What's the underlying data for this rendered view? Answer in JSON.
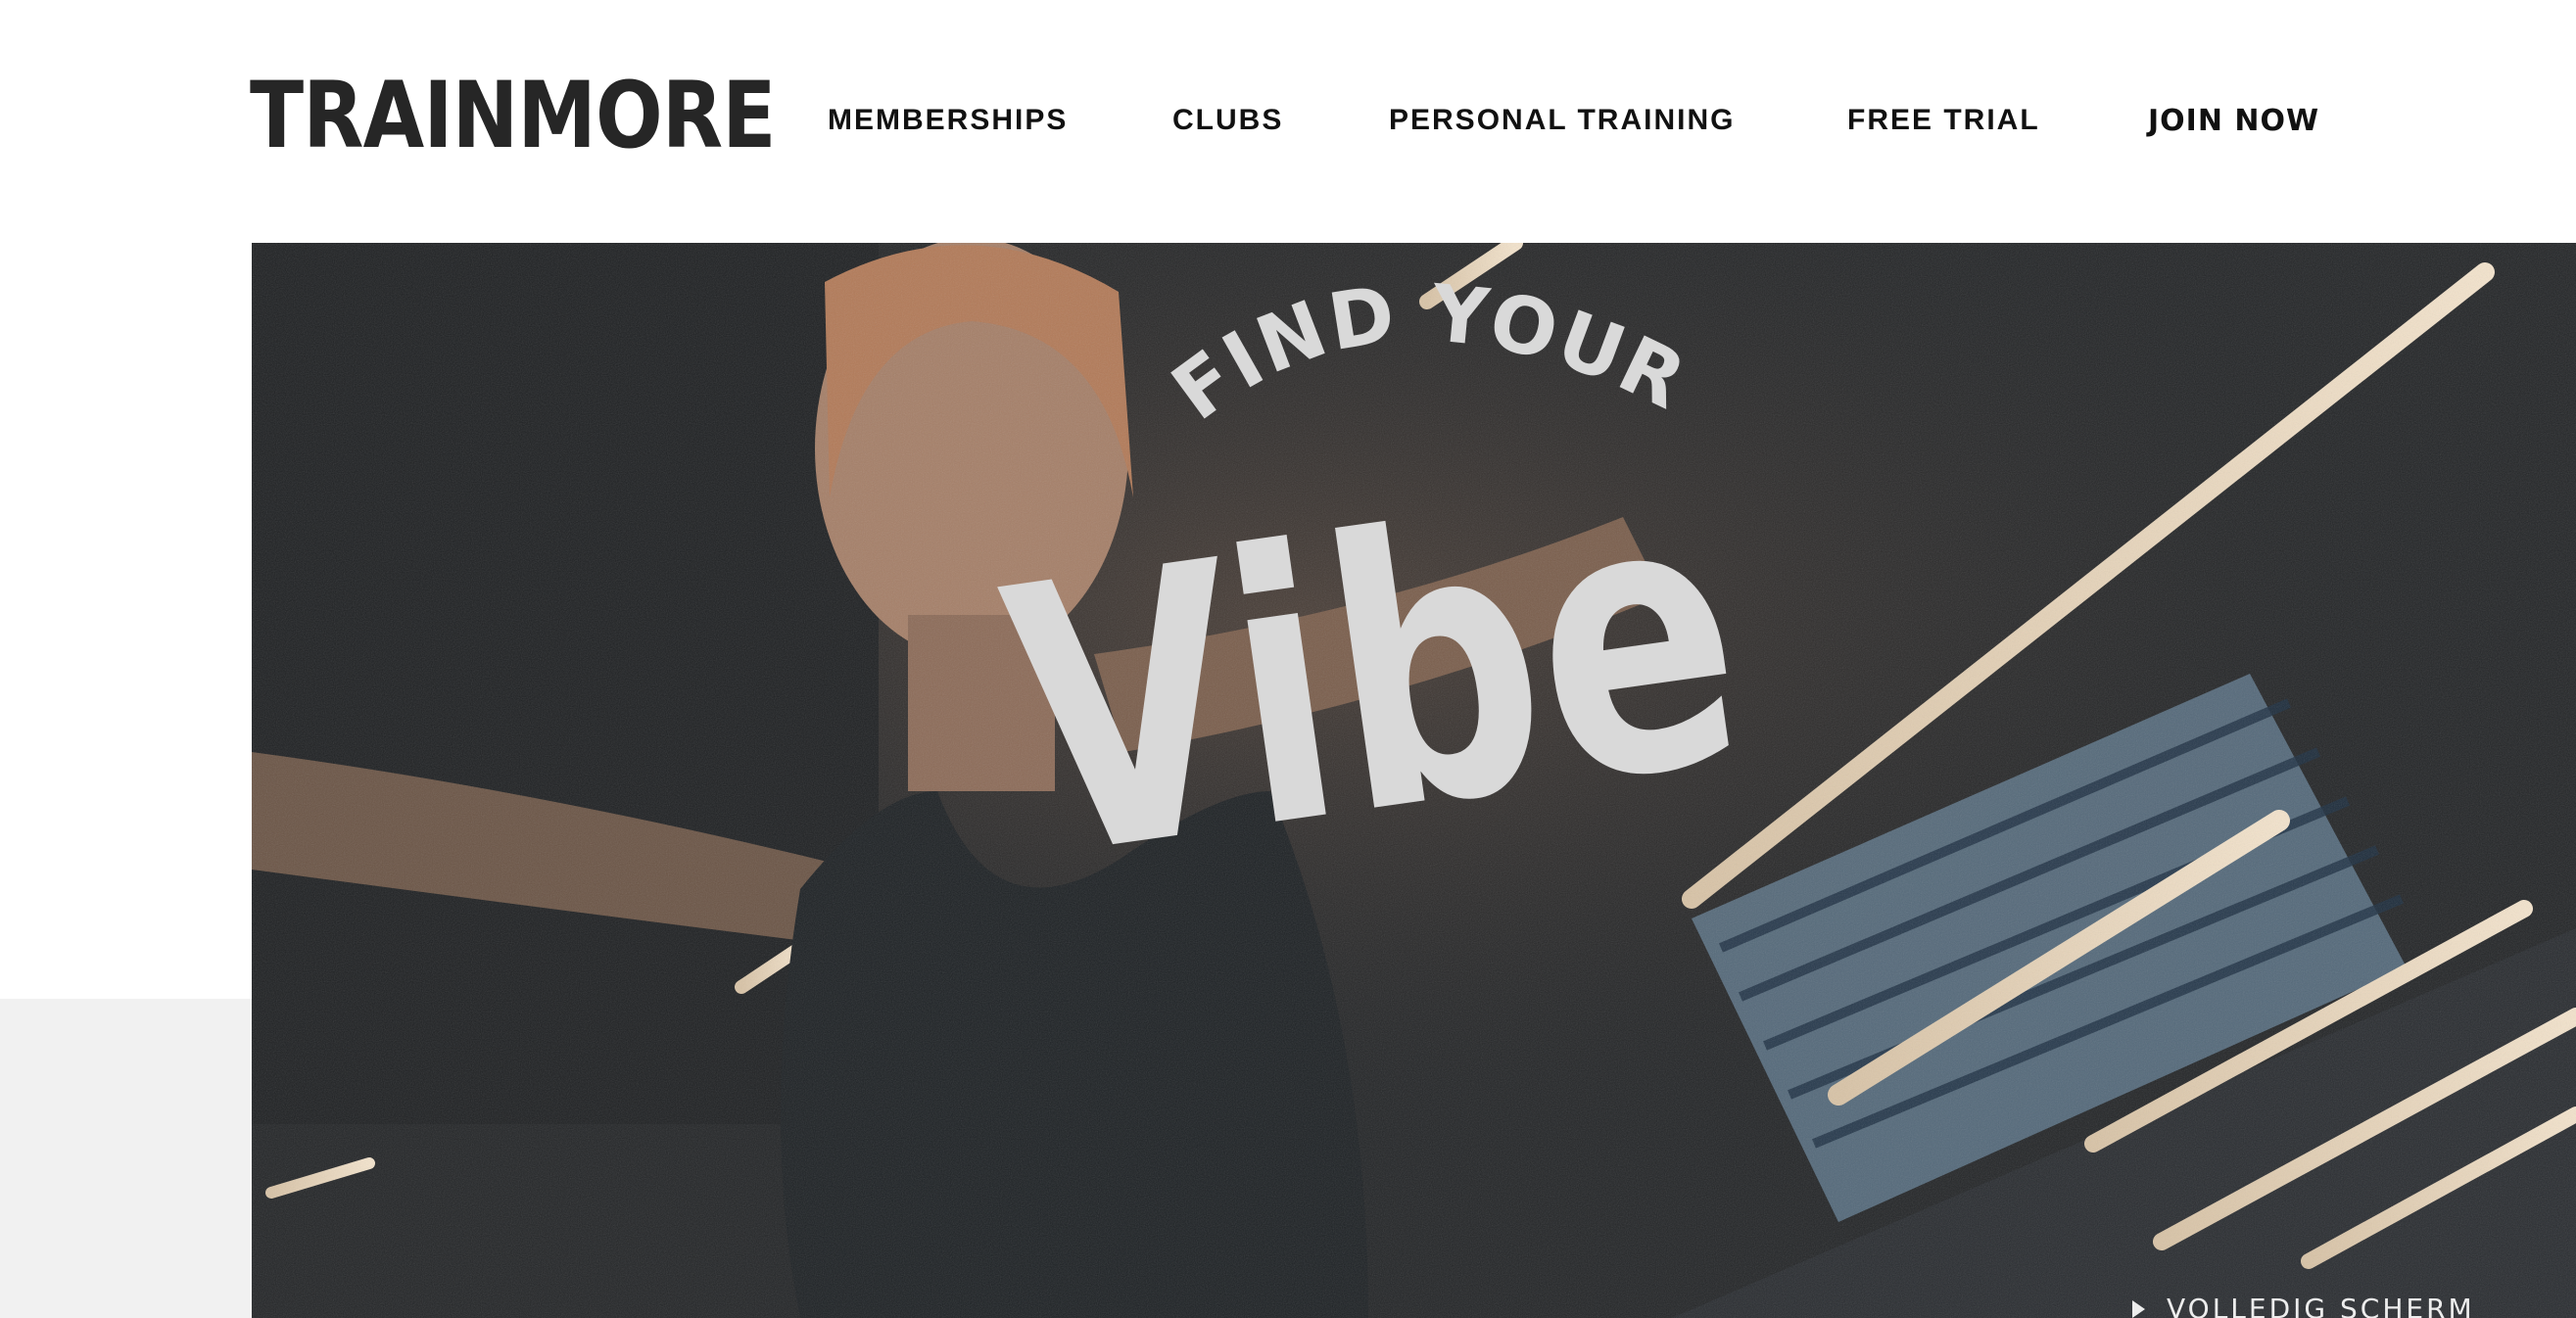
{
  "header": {
    "logo": "TRAINMORE",
    "nav": {
      "memberships": "MEMBERSHIPS",
      "clubs": "CLUBS",
      "personal_training": "PERSONAL TRAINING",
      "free_trial": "FREE TRIAL",
      "join_now": "JOIN NOW"
    }
  },
  "hero": {
    "headline_top": "FIND YOUR",
    "headline_main": "Vibe",
    "fullscreen_label": "VOLLEDIG SCHERM",
    "fullscreen_icon": "play-icon"
  },
  "colors": {
    "logo": "#262626",
    "nav_text": "#111111",
    "hero_text": "#d9d9d9",
    "side_panel": "#f1f1f1"
  }
}
